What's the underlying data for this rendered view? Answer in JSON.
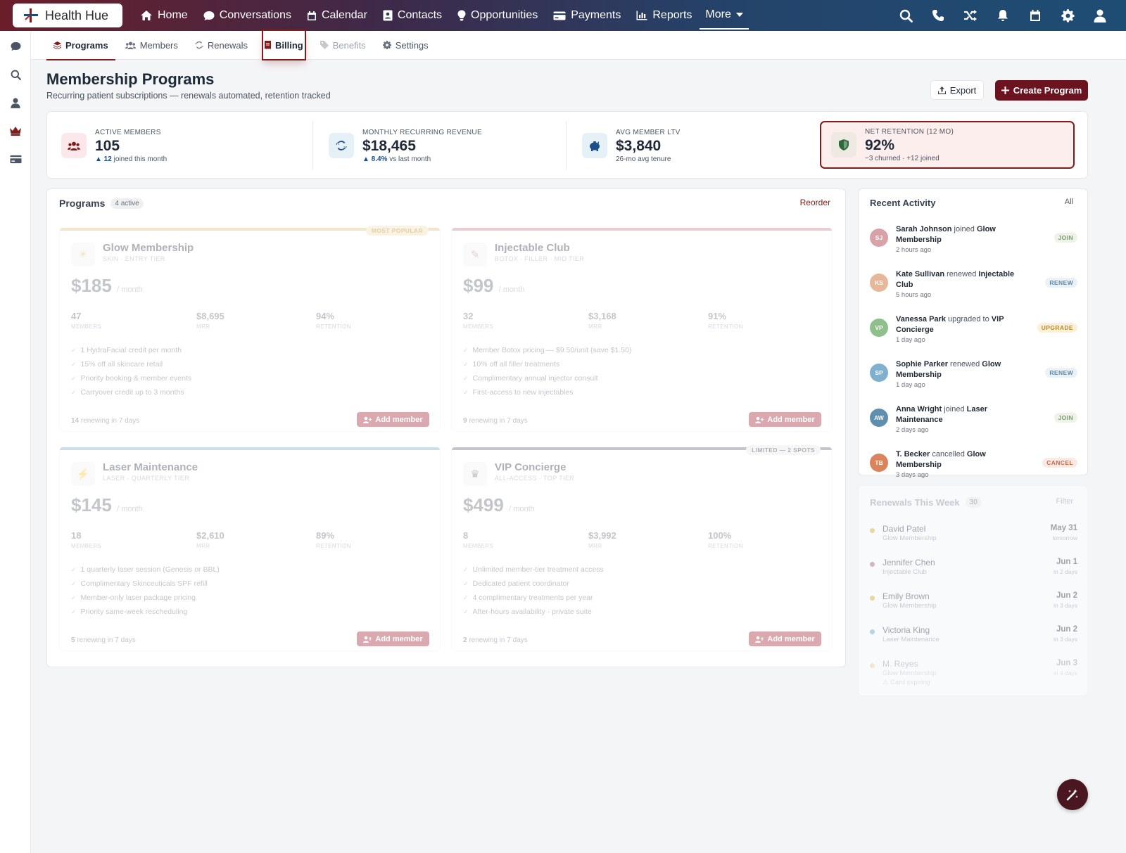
{
  "brand": {
    "name": "Health Hue"
  },
  "nav": {
    "items": [
      {
        "label": "Home",
        "icon": "home-icon"
      },
      {
        "label": "Conversations",
        "icon": "chat-icon"
      },
      {
        "label": "Calendar",
        "icon": "calendar-icon"
      },
      {
        "label": "Contacts",
        "icon": "contact-card-icon"
      },
      {
        "label": "Opportunities",
        "icon": "lightbulb-icon"
      },
      {
        "label": "Payments",
        "icon": "credit-card-icon"
      },
      {
        "label": "Reports",
        "icon": "bar-chart-icon"
      },
      {
        "label": "More",
        "icon": "chevron-down-icon"
      }
    ],
    "right_icons": [
      "search-icon",
      "phone-icon",
      "shuffle-icon",
      "bell-icon",
      "calendar-icon",
      "gear-icon",
      "user-icon"
    ]
  },
  "sidebar": {
    "icons": [
      "chat-icon",
      "search-icon",
      "user-icon",
      "crown-icon",
      "credit-card-icon"
    ]
  },
  "subnav": {
    "tabs": [
      {
        "label": "Programs",
        "icon": "layers-icon"
      },
      {
        "label": "Members",
        "icon": "users-icon"
      },
      {
        "label": "Renewals",
        "icon": "refresh-icon"
      },
      {
        "label": "Billing",
        "icon": "receipt-icon"
      },
      {
        "label": "Benefits",
        "icon": "tag-icon"
      },
      {
        "label": "Settings",
        "icon": "gear-icon"
      }
    ]
  },
  "header": {
    "title": "Membership Programs",
    "subtitle": "Recurring patient subscriptions — renewals automated, retention tracked",
    "export_label": "Export",
    "create_label": "Create Program"
  },
  "stats": [
    {
      "label": "ACTIVE MEMBERS",
      "value": "105",
      "delta_strong": "▲ 12",
      "delta_rest": " joined this month",
      "icon": "users-icon"
    },
    {
      "label": "MONTHLY RECURRING REVENUE",
      "value": "$18,465",
      "delta_strong": "▲ 8.4%",
      "delta_rest": " vs last month",
      "icon": "refresh-icon"
    },
    {
      "label": "AVG MEMBER LTV",
      "value": "$3,840",
      "delta_strong": "",
      "delta_rest": "26-mo avg tenure",
      "icon": "piggy-bank-icon"
    },
    {
      "label": "NET RETENTION (12 MO)",
      "value": "92%",
      "delta_strong": "",
      "delta_rest": "−3 churned · +12 joined",
      "icon": "shield-icon"
    }
  ],
  "programs": {
    "title": "Programs",
    "count_badge": "4 active",
    "reorder_label": "Reorder",
    "cards": [
      {
        "name": "Glow Membership",
        "tier": "SKIN · ENTRY TIER",
        "price": "$185",
        "per": "/ month",
        "ribbon": "MOST POPULAR",
        "metrics": [
          {
            "value": "47",
            "label": "MEMBERS"
          },
          {
            "value": "$8,695",
            "label": "MRR"
          },
          {
            "value": "94%",
            "label": "RETENTION"
          }
        ],
        "features": [
          "1 HydraFacial credit per month",
          "15% off all skincare retail",
          "Priority booking & member events",
          "Carryover credit up to 3 months"
        ],
        "renew_count": "14",
        "renew_text": " renewing in 7 days",
        "add_label": "Add member"
      },
      {
        "name": "Injectable Club",
        "tier": "BOTOX · FILLER · MID TIER",
        "price": "$99",
        "per": "/ month",
        "ribbon": "",
        "metrics": [
          {
            "value": "32",
            "label": "MEMBERS"
          },
          {
            "value": "$3,168",
            "label": "MRR"
          },
          {
            "value": "91%",
            "label": "RETENTION"
          }
        ],
        "features": [
          "Member Botox pricing — $9.50/unit (save $1.50)",
          "10% off all filler treatments",
          "Complimentary annual injector consult",
          "First-access to new injectables"
        ],
        "renew_count": "9",
        "renew_text": " renewing in 7 days",
        "add_label": "Add member"
      },
      {
        "name": "Laser Maintenance",
        "tier": "LASER · QUARTERLY TIER",
        "price": "$145",
        "per": "/ month",
        "ribbon": "",
        "metrics": [
          {
            "value": "18",
            "label": "MEMBERS"
          },
          {
            "value": "$2,610",
            "label": "MRR"
          },
          {
            "value": "89%",
            "label": "RETENTION"
          }
        ],
        "features": [
          "1 quarterly laser session (Genesis or BBL)",
          "Complimentary Skinceuticals SPF refill",
          "Member-only laser package pricing",
          "Priority same-week rescheduling"
        ],
        "renew_count": "5",
        "renew_text": " renewing in 7 days",
        "add_label": "Add member"
      },
      {
        "name": "VIP Concierge",
        "tier": "ALL-ACCESS · TOP TIER",
        "price": "$499",
        "per": "/ month",
        "ribbon": "LIMITED — 2 SPOTS",
        "metrics": [
          {
            "value": "8",
            "label": "MEMBERS"
          },
          {
            "value": "$3,992",
            "label": "MRR"
          },
          {
            "value": "100%",
            "label": "RETENTION"
          }
        ],
        "features": [
          "Unlimited member-tier treatment access",
          "Dedicated patient coordinator",
          "4 complimentary treatments per year",
          "After-hours availability · private suite"
        ],
        "renew_count": "2",
        "renew_text": " renewing in 7 days",
        "add_label": "Add member"
      }
    ]
  },
  "activity": {
    "title": "Recent Activity",
    "all_label": "All",
    "items": [
      {
        "initials": "SJ",
        "name": "Sarah Johnson",
        "action": " joined ",
        "target": "Glow Membership",
        "time": "2 hours ago",
        "tag": "JOIN",
        "color": "#d7a3a8"
      },
      {
        "initials": "KS",
        "name": "Kate Sullivan",
        "action": " renewed ",
        "target": "Injectable Club",
        "time": "5 hours ago",
        "tag": "RENEW",
        "color": "#e7b79a"
      },
      {
        "initials": "VP",
        "name": "Vanessa Park",
        "action": " upgraded to ",
        "target": "VIP Concierge",
        "time": "1 day ago",
        "tag": "UPGRADE",
        "color": "#8fbf8a"
      },
      {
        "initials": "SP",
        "name": "Sophie Parker",
        "action": " renewed ",
        "target": "Glow Membership",
        "time": "1 day ago",
        "tag": "RENEW",
        "color": "#7fb0cf"
      },
      {
        "initials": "AW",
        "name": "Anna Wright",
        "action": " joined ",
        "target": "Laser Maintenance",
        "time": "2 days ago",
        "tag": "JOIN",
        "color": "#5f8fae"
      },
      {
        "initials": "TB",
        "name": "T. Becker",
        "action": " cancelled ",
        "target": "Glow Membership",
        "time": "3 days ago",
        "tag": "CANCEL",
        "color": "#d9845c"
      }
    ]
  },
  "renewals": {
    "title": "Renewals This Week",
    "count_badge": "30",
    "filter_label": "Filter",
    "items": [
      {
        "name": "David Patel",
        "program": "Glow Membership",
        "date": "May 31",
        "due": "tomorrow",
        "color": "#e0b552"
      },
      {
        "name": "Jennifer Chen",
        "program": "Injectable Club",
        "date": "Jun 1",
        "due": "in 2 days",
        "color": "#b57884"
      },
      {
        "name": "Emily Brown",
        "program": "Glow Membership",
        "date": "Jun 2",
        "due": "in 3 days",
        "color": "#e0b552"
      },
      {
        "name": "Victoria King",
        "program": "Laser Maintenance",
        "date": "Jun 2",
        "due": "in 3 days",
        "color": "#7fb5c2"
      },
      {
        "name": "M. Reyes",
        "program": "Glow Membership",
        "date": "Jun 3",
        "due": "in 4 days",
        "note": "⚠ Card expiring",
        "color": "#e0b552"
      }
    ]
  },
  "colors": {
    "brand": "#6b1420",
    "accent_blue": "#1d4e89"
  }
}
